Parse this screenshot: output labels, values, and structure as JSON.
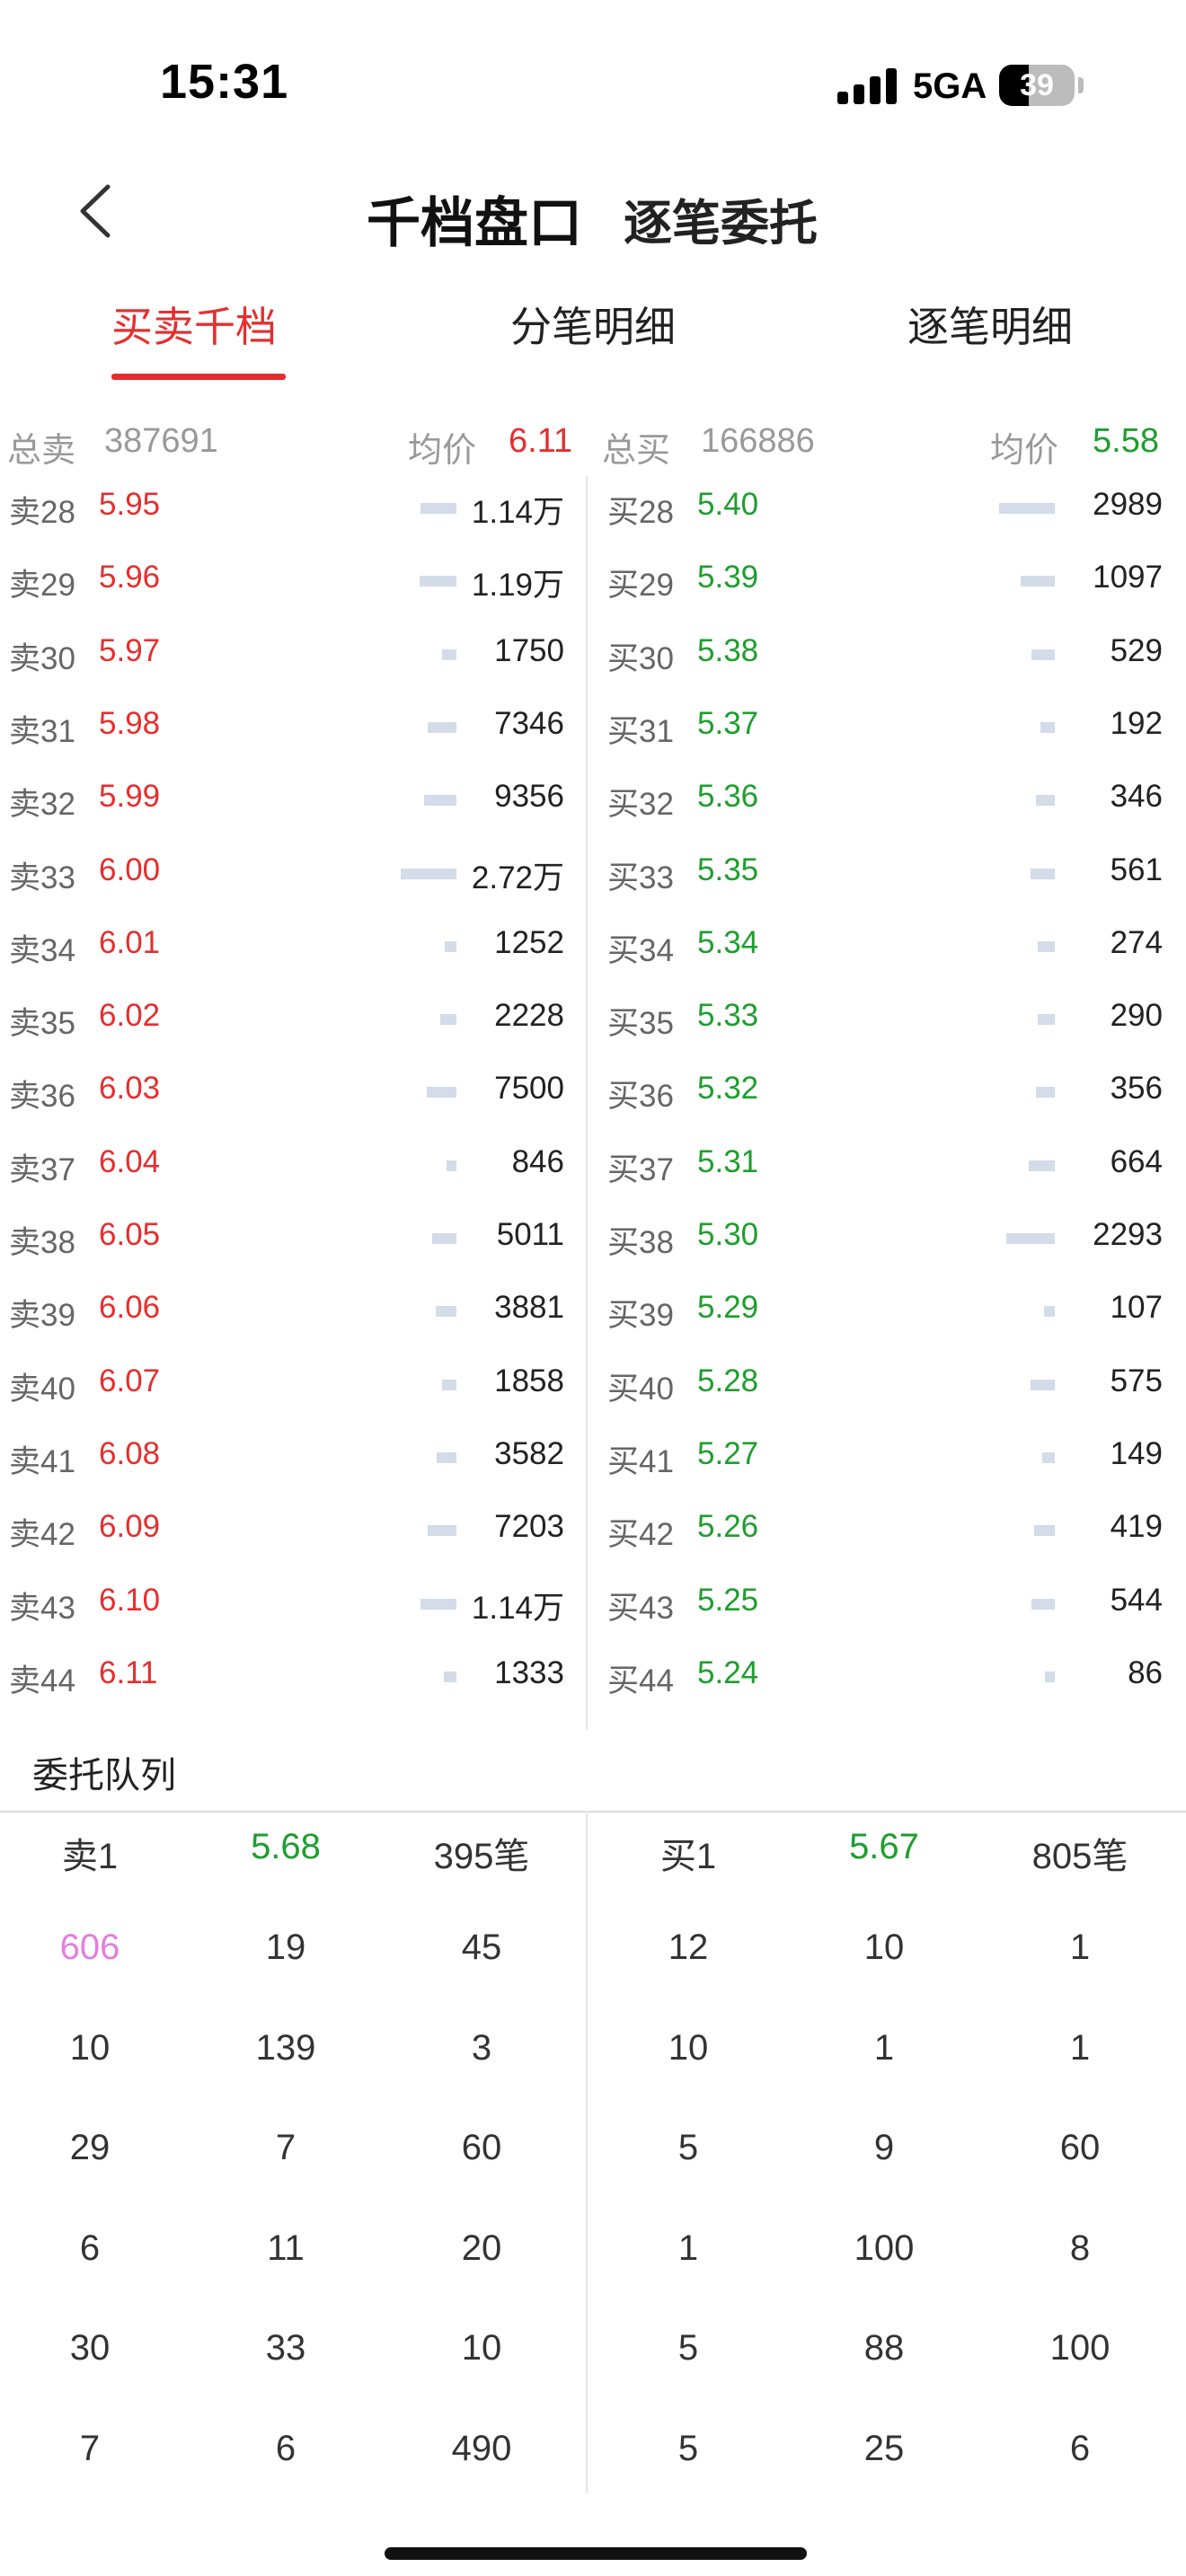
{
  "status_bar": {
    "time": "15:31",
    "network": "5GA",
    "battery": "39",
    "battery_level": 0.39,
    "icons": [
      "signal-icon",
      "battery-icon"
    ]
  },
  "header": {
    "back_icon": "chevron-left-icon",
    "title": "千档盘口",
    "subtitle": "逐笔委托"
  },
  "tabs": [
    {
      "label": "买卖千档",
      "active": true
    },
    {
      "label": "分笔明细",
      "active": false
    },
    {
      "label": "逐笔明细",
      "active": false
    }
  ],
  "summary": {
    "sell_label": "总卖",
    "sell_total": "387691",
    "sell_avg_label": "均价",
    "sell_avg": "6.11",
    "buy_label": "总买",
    "buy_total": "166886",
    "buy_avg_label": "均价",
    "buy_avg": "5.58"
  },
  "asks": [
    {
      "level": "卖28",
      "price": "5.95",
      "volume": "1.14万",
      "volume_num": 11400
    },
    {
      "level": "卖29",
      "price": "5.96",
      "volume": "1.19万",
      "volume_num": 11900
    },
    {
      "level": "卖30",
      "price": "5.97",
      "volume": "1750",
      "volume_num": 1750
    },
    {
      "level": "卖31",
      "price": "5.98",
      "volume": "7346",
      "volume_num": 7346
    },
    {
      "level": "卖32",
      "price": "5.99",
      "volume": "9356",
      "volume_num": 9356
    },
    {
      "level": "卖33",
      "price": "6.00",
      "volume": "2.72万",
      "volume_num": 27200
    },
    {
      "level": "卖34",
      "price": "6.01",
      "volume": "1252",
      "volume_num": 1252
    },
    {
      "level": "卖35",
      "price": "6.02",
      "volume": "2228",
      "volume_num": 2228
    },
    {
      "level": "卖36",
      "price": "6.03",
      "volume": "7500",
      "volume_num": 7500
    },
    {
      "level": "卖37",
      "price": "6.04",
      "volume": "846",
      "volume_num": 846
    },
    {
      "level": "卖38",
      "price": "6.05",
      "volume": "5011",
      "volume_num": 5011
    },
    {
      "level": "卖39",
      "price": "6.06",
      "volume": "3881",
      "volume_num": 3881
    },
    {
      "level": "卖40",
      "price": "6.07",
      "volume": "1858",
      "volume_num": 1858
    },
    {
      "level": "卖41",
      "price": "6.08",
      "volume": "3582",
      "volume_num": 3582
    },
    {
      "level": "卖42",
      "price": "6.09",
      "volume": "7203",
      "volume_num": 7203
    },
    {
      "level": "卖43",
      "price": "6.10",
      "volume": "1.14万",
      "volume_num": 11400
    },
    {
      "level": "卖44",
      "price": "6.11",
      "volume": "1333",
      "volume_num": 1333
    }
  ],
  "bids": [
    {
      "level": "买28",
      "price": "5.40",
      "volume": "2989",
      "volume_num": 2989
    },
    {
      "level": "买29",
      "price": "5.39",
      "volume": "1097",
      "volume_num": 1097
    },
    {
      "level": "买30",
      "price": "5.38",
      "volume": "529",
      "volume_num": 529
    },
    {
      "level": "买31",
      "price": "5.37",
      "volume": "192",
      "volume_num": 192
    },
    {
      "level": "买32",
      "price": "5.36",
      "volume": "346",
      "volume_num": 346
    },
    {
      "level": "买33",
      "price": "5.35",
      "volume": "561",
      "volume_num": 561
    },
    {
      "level": "买34",
      "price": "5.34",
      "volume": "274",
      "volume_num": 274
    },
    {
      "level": "买35",
      "price": "5.33",
      "volume": "290",
      "volume_num": 290
    },
    {
      "level": "买36",
      "price": "5.32",
      "volume": "356",
      "volume_num": 356
    },
    {
      "level": "买37",
      "price": "5.31",
      "volume": "664",
      "volume_num": 664
    },
    {
      "level": "买38",
      "price": "5.30",
      "volume": "2293",
      "volume_num": 2293
    },
    {
      "level": "买39",
      "price": "5.29",
      "volume": "107",
      "volume_num": 107
    },
    {
      "level": "买40",
      "price": "5.28",
      "volume": "575",
      "volume_num": 575
    },
    {
      "level": "买41",
      "price": "5.27",
      "volume": "149",
      "volume_num": 149
    },
    {
      "level": "买42",
      "price": "5.26",
      "volume": "419",
      "volume_num": 419
    },
    {
      "level": "买43",
      "price": "5.25",
      "volume": "544",
      "volume_num": 544
    },
    {
      "level": "买44",
      "price": "5.24",
      "volume": "86",
      "volume_num": 86
    }
  ],
  "queue": {
    "title": "委托队列",
    "sell": {
      "label": "卖1",
      "price": "5.68",
      "count": "395笔",
      "cells": [
        "606",
        "19",
        "45",
        "10",
        "139",
        "3",
        "29",
        "7",
        "60",
        "6",
        "11",
        "20",
        "30",
        "33",
        "10",
        "7",
        "6",
        "490"
      ]
    },
    "buy": {
      "label": "买1",
      "price": "5.67",
      "count": "805笔",
      "cells": [
        "12",
        "10",
        "1",
        "10",
        "1",
        "1",
        "5",
        "9",
        "60",
        "1",
        "100",
        "8",
        "5",
        "88",
        "100",
        "5",
        "25",
        "6"
      ]
    },
    "highlight_color": "#e47de0"
  },
  "colors": {
    "red": "#e62e2e",
    "green": "#1e9e2e",
    "bar": "#d3dce8"
  }
}
